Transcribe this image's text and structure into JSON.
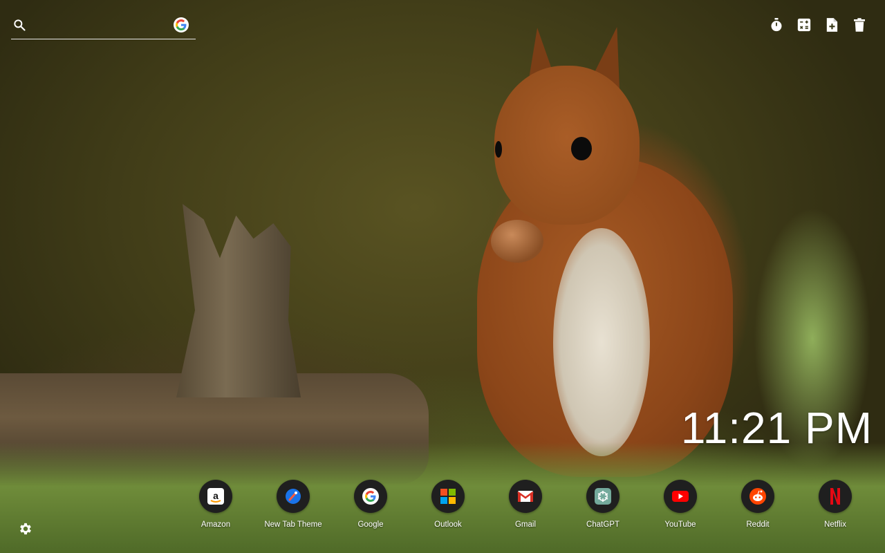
{
  "search": {
    "placeholder": "",
    "engine_icon": "google-g-icon"
  },
  "tools": [
    {
      "name": "timer-icon"
    },
    {
      "name": "calculator-icon"
    },
    {
      "name": "add-note-icon"
    },
    {
      "name": "trash-icon"
    }
  ],
  "clock": {
    "time": "11:21 PM"
  },
  "dock": {
    "apps": [
      {
        "label": "Amazon",
        "icon": "amazon-icon"
      },
      {
        "label": "New Tab Theme",
        "icon": "new-tab-theme-icon"
      },
      {
        "label": "Google",
        "icon": "google-icon"
      },
      {
        "label": "Outlook",
        "icon": "outlook-icon"
      },
      {
        "label": "Gmail",
        "icon": "gmail-icon"
      },
      {
        "label": "ChatGPT",
        "icon": "chatgpt-icon"
      },
      {
        "label": "YouTube",
        "icon": "youtube-icon"
      },
      {
        "label": "Reddit",
        "icon": "reddit-icon"
      },
      {
        "label": "Netflix",
        "icon": "netflix-icon"
      }
    ]
  },
  "settings": {
    "icon": "gear-icon"
  },
  "colors": {
    "text": "#ffffff",
    "dock_icon_bg": "#1f1f1f",
    "youtube_red": "#ff0000",
    "netflix_red": "#e50914",
    "reddit_orange": "#ff4500"
  }
}
